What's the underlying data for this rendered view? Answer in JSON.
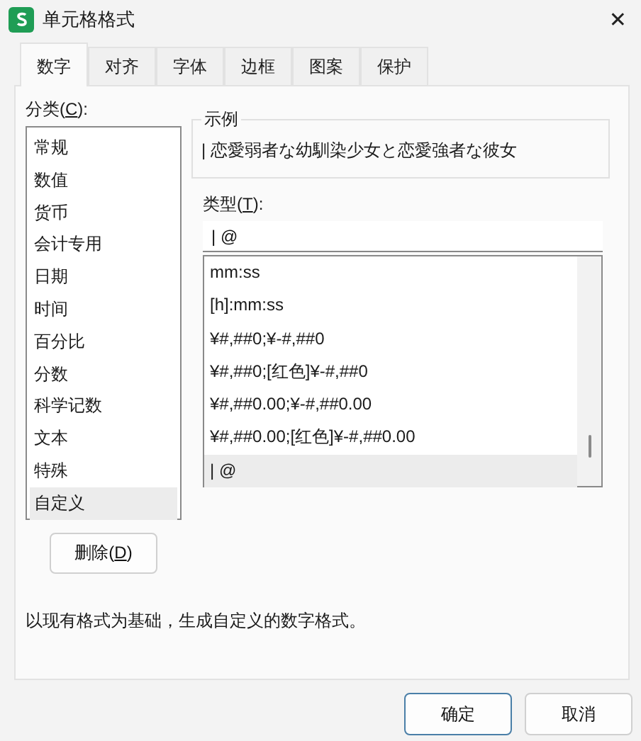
{
  "window": {
    "title": "单元格格式",
    "close": "✕"
  },
  "tabs": [
    {
      "label": "数字",
      "selected": true
    },
    {
      "label": "对齐",
      "selected": false
    },
    {
      "label": "字体",
      "selected": false
    },
    {
      "label": "边框",
      "selected": false
    },
    {
      "label": "图案",
      "selected": false
    },
    {
      "label": "保护",
      "selected": false
    }
  ],
  "category_label": {
    "before": "分类(",
    "key": "C",
    "after": "):"
  },
  "categories": [
    {
      "label": "常规",
      "selected": false
    },
    {
      "label": "数值",
      "selected": false
    },
    {
      "label": "货币",
      "selected": false
    },
    {
      "label": "会计专用",
      "selected": false
    },
    {
      "label": "日期",
      "selected": false
    },
    {
      "label": "时间",
      "selected": false
    },
    {
      "label": "百分比",
      "selected": false
    },
    {
      "label": "分数",
      "selected": false
    },
    {
      "label": "科学记数",
      "selected": false
    },
    {
      "label": "文本",
      "selected": false
    },
    {
      "label": "特殊",
      "selected": false
    },
    {
      "label": "自定义",
      "selected": true
    }
  ],
  "sample": {
    "legend": "示例",
    "text": "| 恋愛弱者な幼馴染少女と恋愛強者な彼女"
  },
  "type_label": {
    "before": "类型(",
    "key": "T",
    "after": "):"
  },
  "type_field": {
    "value": "| @"
  },
  "formats": [
    {
      "label": "mm:ss",
      "selected": false
    },
    {
      "label": "[h]:mm:ss",
      "selected": false
    },
    {
      "label": "¥#,##0;¥-#,##0",
      "selected": false
    },
    {
      "label": "¥#,##0;[红色]¥-#,##0",
      "selected": false
    },
    {
      "label": "¥#,##0.00;¥-#,##0.00",
      "selected": false
    },
    {
      "label": "¥#,##0.00;[红色]¥-#,##0.00",
      "selected": false
    },
    {
      "label": "| @",
      "selected": true
    }
  ],
  "delete_button": {
    "before": "删除(",
    "key": "D",
    "after": ")"
  },
  "description": "以现有格式为基础，生成自定义的数字格式。",
  "buttons": [
    {
      "label": "确定",
      "kind": "primary"
    },
    {
      "label": "取消",
      "kind": "normal"
    }
  ]
}
